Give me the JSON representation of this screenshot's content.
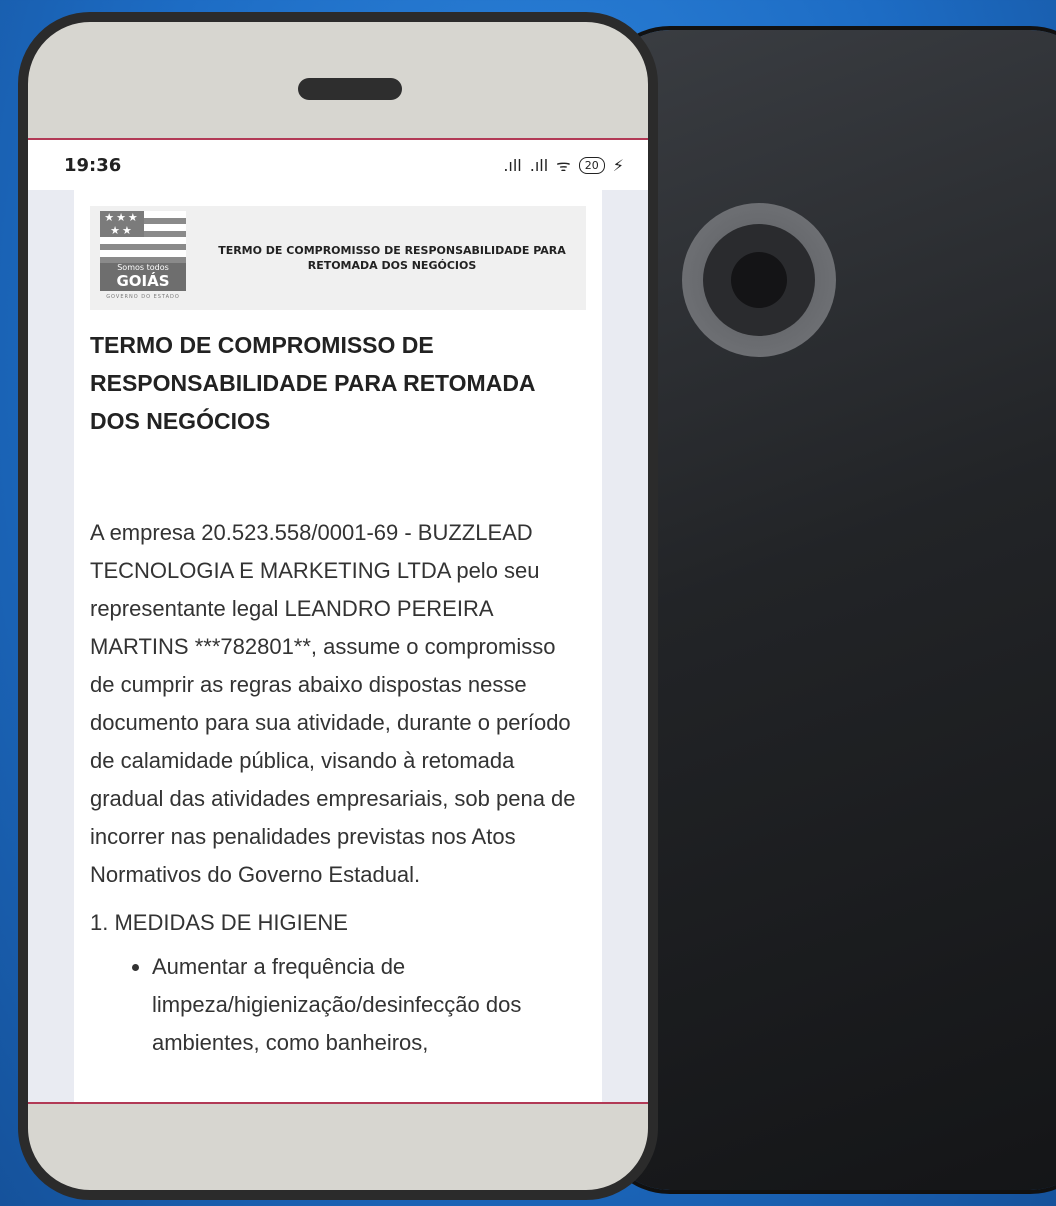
{
  "status_bar": {
    "time": "19:36",
    "signal_1": ".ıll",
    "signal_2": ".ıll",
    "wifi": "ᯤ",
    "battery": "20",
    "charging": "⚡"
  },
  "document": {
    "logo": {
      "small_text": "Somos todos",
      "big_text": "GOIÁS",
      "caption": "GOVERNO DO ESTADO"
    },
    "header_title": "TERMO DE COMPROMISSO DE RESPONSABILIDADE PARA RETOMADA DOS NEGÓCIOS",
    "title": "TERMO DE COMPROMISSO DE RESPONSABILIDADE PARA RETOMADA DOS NEGÓCIOS",
    "body": "A empresa 20.523.558/0001-69 - BUZZLEAD TECNOLOGIA E MARKETING LTDA pelo seu representante legal LEANDRO PEREIRA MARTINS ***782801**, assume o compromisso de cumprir as regras abaixo dispostas nesse documento para sua atividade, durante o período de calamidade pública, visando à retomada gradual das atividades empresariais, sob pena de incorrer nas penalidades previstas nos Atos Normativos do Governo Estadual.",
    "section_1_title": "1. MEDIDAS DE HIGIENE",
    "section_1_items": [
      "Aumentar a frequência de limpeza/higienização/desinfecção dos ambientes, como banheiros,"
    ]
  },
  "colors": {
    "background": "#1d6cc4",
    "phone_frame": "#d7d6d0",
    "screen_border": "#b23a56"
  }
}
